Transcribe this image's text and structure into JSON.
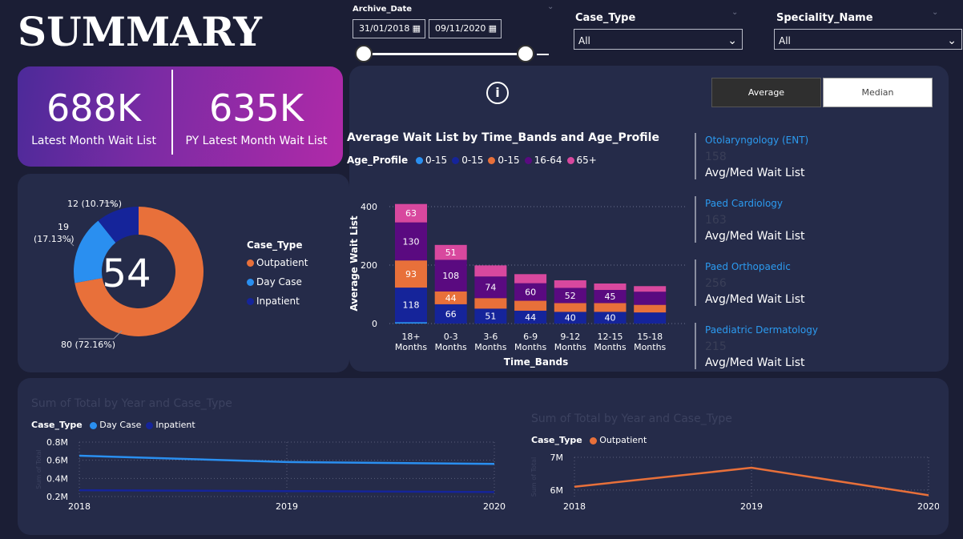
{
  "header": {
    "title": "SUMMARY"
  },
  "filters": {
    "archive_date": {
      "label": "Archive_Date",
      "start": "31/01/2018",
      "end": "09/11/2020"
    },
    "case_type": {
      "label": "Case_Type",
      "value": "All"
    },
    "speciality": {
      "label": "Speciality_Name",
      "value": "All"
    }
  },
  "kpi": {
    "latest": {
      "value": "688K",
      "label": "Latest Month Wait List"
    },
    "py_latest": {
      "value": "635K",
      "label": "PY Latest Month Wait List"
    }
  },
  "donut": {
    "center": "54",
    "legend_title": "Case_Type",
    "colors": {
      "Outpatient": "#e8703a",
      "Day Case": "#2a8ff0",
      "Inpatient": "#15249a"
    },
    "labels": {
      "outpatient": "80 (72.16%)",
      "daycase_count": "19",
      "daycase_pct": "(17.13%)",
      "inpatient": "12 (10.71%)"
    }
  },
  "toggle": {
    "average": "Average",
    "median": "Median",
    "info_icon": "info-icon"
  },
  "entities": [
    {
      "name": "Otolaryngology (ENT)",
      "value": "158",
      "label": "Avg/Med Wait List"
    },
    {
      "name": "Paed Cardiology",
      "value": "163",
      "label": "Avg/Med Wait List"
    },
    {
      "name": "Paed Orthopaedic",
      "value": "256",
      "label": "Avg/Med Wait List"
    },
    {
      "name": "Paediatric Dermatology",
      "value": "215",
      "label": "Avg/Med Wait List"
    }
  ],
  "chart_data": [
    {
      "type": "bar",
      "stacked": true,
      "title": "Average Wait List by Time_Bands and Age_Profile",
      "legend_title": "Age_Profile",
      "xlabel": "Time_Bands",
      "ylabel": "Average Wait List",
      "ylim": [
        0,
        420
      ],
      "yticks": [
        0,
        200,
        400
      ],
      "categories": [
        [
          "18+",
          "Months"
        ],
        [
          "0-3",
          "Months"
        ],
        [
          "3-6",
          "Months"
        ],
        [
          "6-9",
          "Months"
        ],
        [
          "9-12",
          "Months"
        ],
        [
          "12-15",
          "Months"
        ],
        [
          "15-18",
          "Months"
        ]
      ],
      "series": [
        {
          "name": "0-15",
          "color": "#2a8ff0",
          "values": [
            5,
            0,
            0,
            0,
            0,
            0,
            0
          ],
          "labels": [
            "",
            "",
            "",
            "",
            "",
            "",
            ""
          ]
        },
        {
          "name": "0-15",
          "color": "#15249a",
          "values": [
            118,
            66,
            51,
            44,
            40,
            40,
            38
          ],
          "labels": [
            "118",
            "66",
            "51",
            "44",
            "40",
            "40",
            ""
          ]
        },
        {
          "name": "0-15",
          "color": "#e8703a",
          "values": [
            93,
            44,
            36,
            34,
            30,
            30,
            26
          ],
          "labels": [
            "93",
            "44",
            "",
            "",
            "",
            "",
            ""
          ]
        },
        {
          "name": "16-64",
          "color": "#5a0a80",
          "values": [
            130,
            108,
            74,
            60,
            52,
            45,
            45
          ],
          "labels": [
            "130",
            "108",
            "74",
            "60",
            "52",
            "45",
            ""
          ]
        },
        {
          "name": "65+",
          "color": "#d8489e",
          "values": [
            63,
            51,
            38,
            31,
            26,
            22,
            19
          ],
          "labels": [
            "63",
            "51",
            "",
            "",
            "",
            "",
            ""
          ]
        }
      ]
    },
    {
      "type": "line",
      "title": "Sum of Total by Year and Case_Type",
      "legend_title": "Case_Type",
      "ylabel": "Sum of Total",
      "x": [
        "2018",
        "2019",
        "2020"
      ],
      "ylim": [
        0.2,
        0.8
      ],
      "yticks": [
        "0.2M",
        "0.4M",
        "0.6M",
        "0.8M"
      ],
      "series": [
        {
          "name": "Day Case",
          "color": "#2a8ff0",
          "values": [
            0.65,
            0.58,
            0.56
          ]
        },
        {
          "name": "Inpatient",
          "color": "#15249a",
          "values": [
            0.27,
            0.26,
            0.25
          ]
        }
      ]
    },
    {
      "type": "line",
      "title": "Sum of Total by Year and Case_Type",
      "legend_title": "Case_Type",
      "ylabel": "Sum of Total",
      "x": [
        "2018",
        "2019",
        "2020"
      ],
      "ylim": [
        5.8,
        7.0
      ],
      "yticks": [
        "6M",
        "7M"
      ],
      "series": [
        {
          "name": "Outpatient",
          "color": "#e8703a",
          "values": [
            6.1,
            6.68,
            5.84
          ]
        }
      ]
    }
  ]
}
